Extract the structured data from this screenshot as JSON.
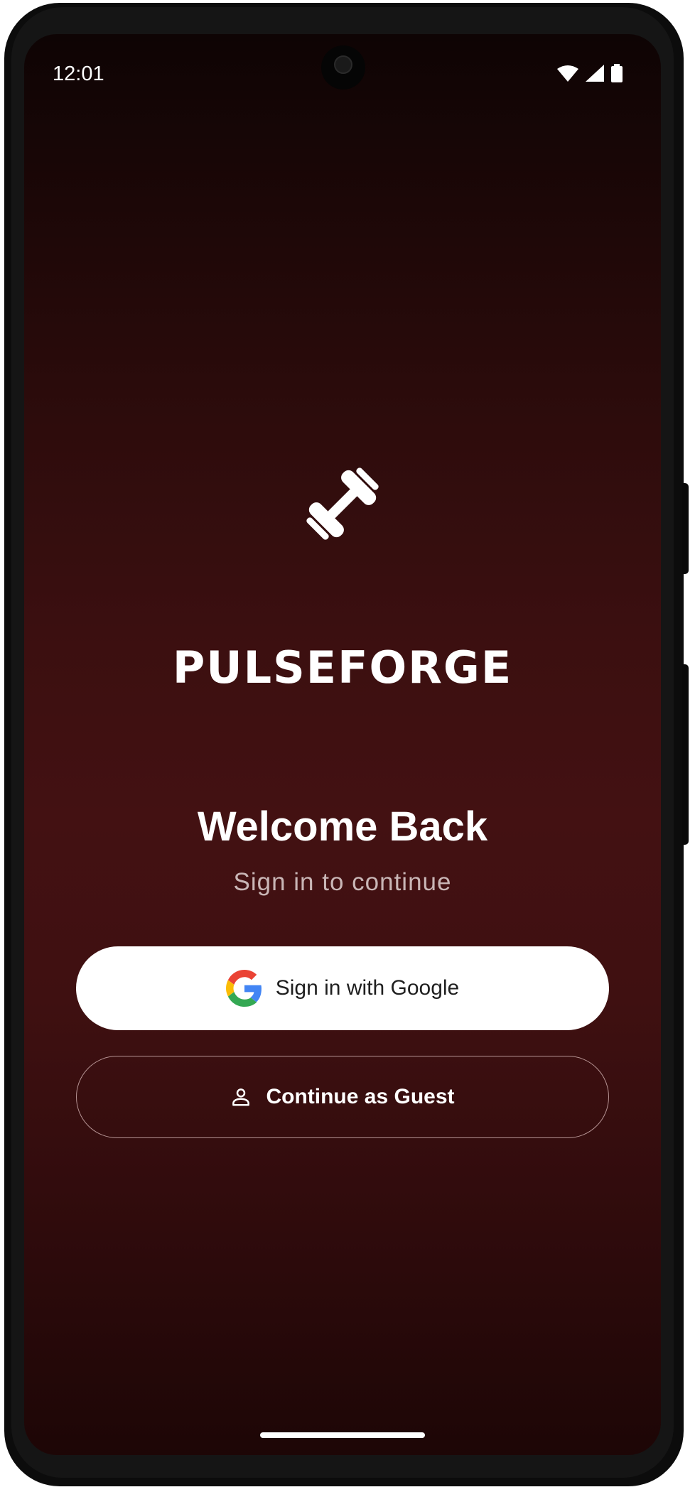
{
  "status_bar": {
    "time": "12:01",
    "icons": [
      "wifi-icon",
      "cell-signal-icon",
      "battery-icon"
    ]
  },
  "brand": {
    "logo_icon": "dumbbell-icon",
    "name": "PULSEFORGE"
  },
  "welcome": {
    "title": "Welcome Back",
    "subtitle": "Sign in to continue"
  },
  "actions": {
    "google_label": "Sign in with Google",
    "google_icon": "google-g-icon",
    "guest_label": "Continue as Guest",
    "guest_icon": "person-icon"
  },
  "colors": {
    "background_top": "#0e0404",
    "background_mid": "#431112",
    "button_primary_bg": "#ffffff",
    "button_outline": "#b69494",
    "subtitle_text": "#c9b6b6"
  }
}
